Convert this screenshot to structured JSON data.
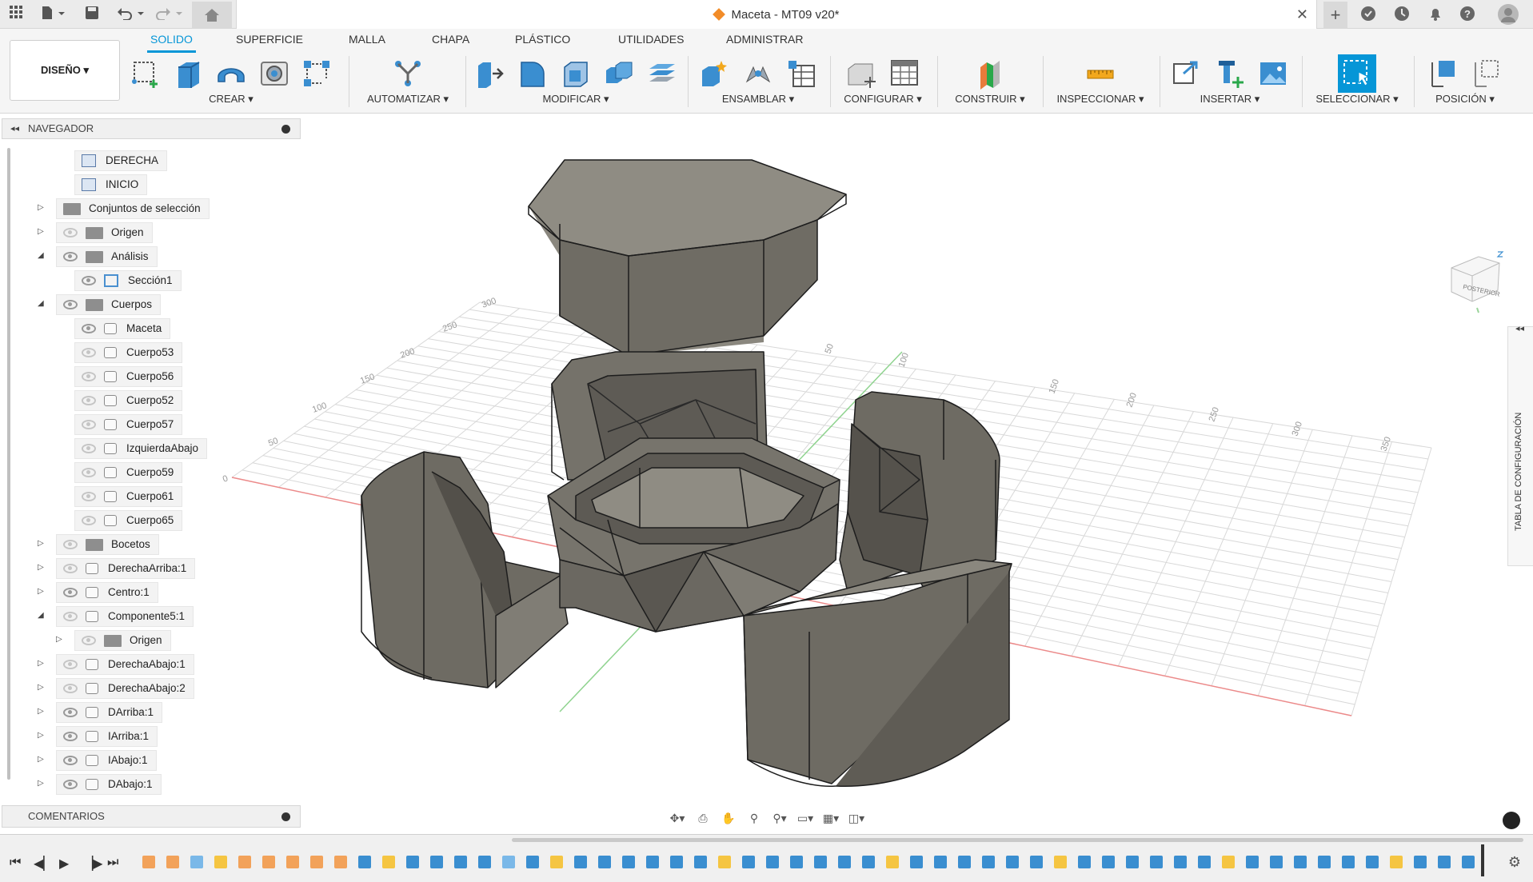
{
  "titlebar": {
    "document_title": "Maceta - MT09 v20*"
  },
  "toolbar": {
    "design_mode": "DISEÑO",
    "tabs": [
      {
        "label": "SOLIDO",
        "active": true
      },
      {
        "label": "SUPERFICIE",
        "active": false
      },
      {
        "label": "MALLA",
        "active": false
      },
      {
        "label": "CHAPA",
        "active": false
      },
      {
        "label": "PLÁSTICO",
        "active": false
      },
      {
        "label": "UTILIDADES",
        "active": false
      },
      {
        "label": "ADMINISTRAR",
        "active": false
      }
    ],
    "groups": [
      {
        "label": "CREAR"
      },
      {
        "label": "AUTOMATIZAR"
      },
      {
        "label": "MODIFICAR"
      },
      {
        "label": "ENSAMBLAR"
      },
      {
        "label": "CONFIGURAR"
      },
      {
        "label": "CONSTRUIR"
      },
      {
        "label": "INSPECCIONAR"
      },
      {
        "label": "INSERTAR"
      },
      {
        "label": "SELECCIONAR"
      },
      {
        "label": "POSICIÓN"
      }
    ]
  },
  "browser": {
    "title": "NAVEGADOR",
    "nodes": [
      {
        "label": "DERECHA"
      },
      {
        "label": "INICIO"
      },
      {
        "label": "Conjuntos de selección"
      },
      {
        "label": "Origen"
      },
      {
        "label": "Análisis"
      },
      {
        "label": "Sección1"
      },
      {
        "label": "Cuerpos"
      },
      {
        "label": "Maceta"
      },
      {
        "label": "Cuerpo53"
      },
      {
        "label": "Cuerpo56"
      },
      {
        "label": "Cuerpo52"
      },
      {
        "label": "Cuerpo57"
      },
      {
        "label": "IzquierdaAbajo"
      },
      {
        "label": "Cuerpo59"
      },
      {
        "label": "Cuerpo61"
      },
      {
        "label": "Cuerpo65"
      },
      {
        "label": "Bocetos"
      },
      {
        "label": "DerechaArriba:1"
      },
      {
        "label": "Centro:1"
      },
      {
        "label": "Componente5:1"
      },
      {
        "label": "Origen"
      },
      {
        "label": "DerechaAbajo:1"
      },
      {
        "label": "DerechaAbajo:2"
      },
      {
        "label": "DArriba:1"
      },
      {
        "label": "IArriba:1"
      },
      {
        "label": "IAbajo:1"
      },
      {
        "label": "DAbajo:1"
      }
    ]
  },
  "comments": {
    "title": "COMENTARIOS"
  },
  "config_panel": {
    "label": "TABLA DE CONFIGURACIÓN"
  },
  "viewcube": {
    "face_label": "POSTERIOR"
  },
  "grid_labels": {
    "left": [
      "300",
      "250",
      "200",
      "150",
      "100",
      "50",
      "0"
    ],
    "right": [
      "50",
      "100",
      "150",
      "200",
      "250",
      "300",
      "350"
    ]
  },
  "colors": {
    "accent": "#0696d7",
    "model_gray": "#6e6b63",
    "grid": "#d8d8d8"
  }
}
